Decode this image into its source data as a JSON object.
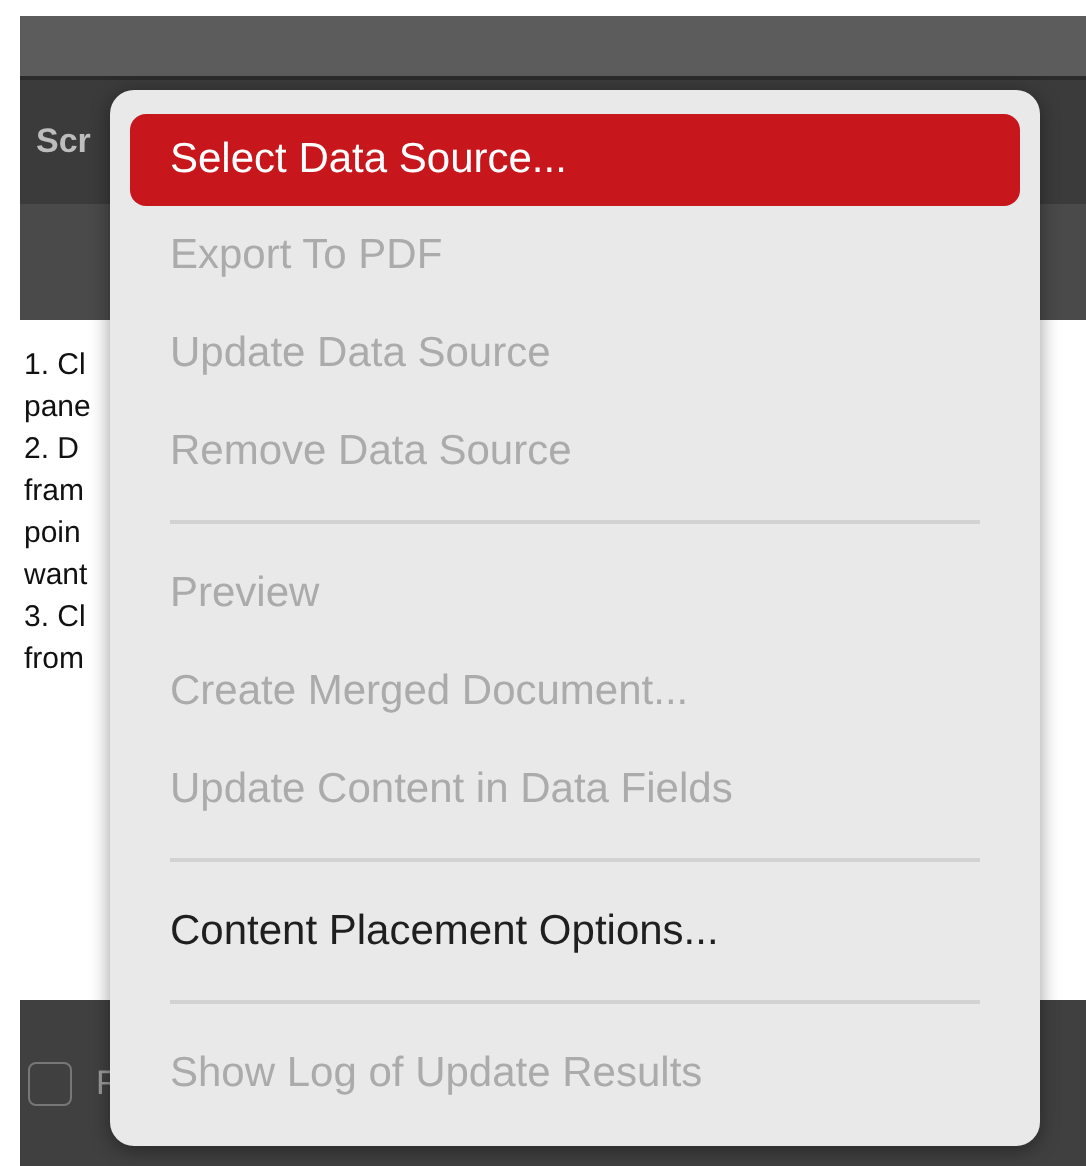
{
  "panel": {
    "tab_label": "Scr",
    "instructions": [
      "1. Cl",
      "pane",
      "2. D",
      "fram",
      "poin",
      "want",
      "3. Cl",
      "from"
    ],
    "footer_checkbox": {
      "label": "F",
      "checked": false
    }
  },
  "context_menu": {
    "items": [
      {
        "kind": "item",
        "label": "Select Data Source...",
        "disabled": false,
        "selected": true
      },
      {
        "kind": "item",
        "label": "Export To PDF",
        "disabled": true,
        "selected": false
      },
      {
        "kind": "item",
        "label": "Update Data Source",
        "disabled": true,
        "selected": false
      },
      {
        "kind": "item",
        "label": "Remove Data Source",
        "disabled": true,
        "selected": false
      },
      {
        "kind": "separator"
      },
      {
        "kind": "item",
        "label": "Preview",
        "disabled": true,
        "selected": false
      },
      {
        "kind": "item",
        "label": "Create Merged Document...",
        "disabled": true,
        "selected": false
      },
      {
        "kind": "item",
        "label": "Update Content in Data Fields",
        "disabled": true,
        "selected": false
      },
      {
        "kind": "separator"
      },
      {
        "kind": "item",
        "label": "Content Placement Options...",
        "disabled": false,
        "selected": false
      },
      {
        "kind": "separator"
      },
      {
        "kind": "item",
        "label": "Show Log of Update Results",
        "disabled": true,
        "selected": false
      }
    ]
  }
}
